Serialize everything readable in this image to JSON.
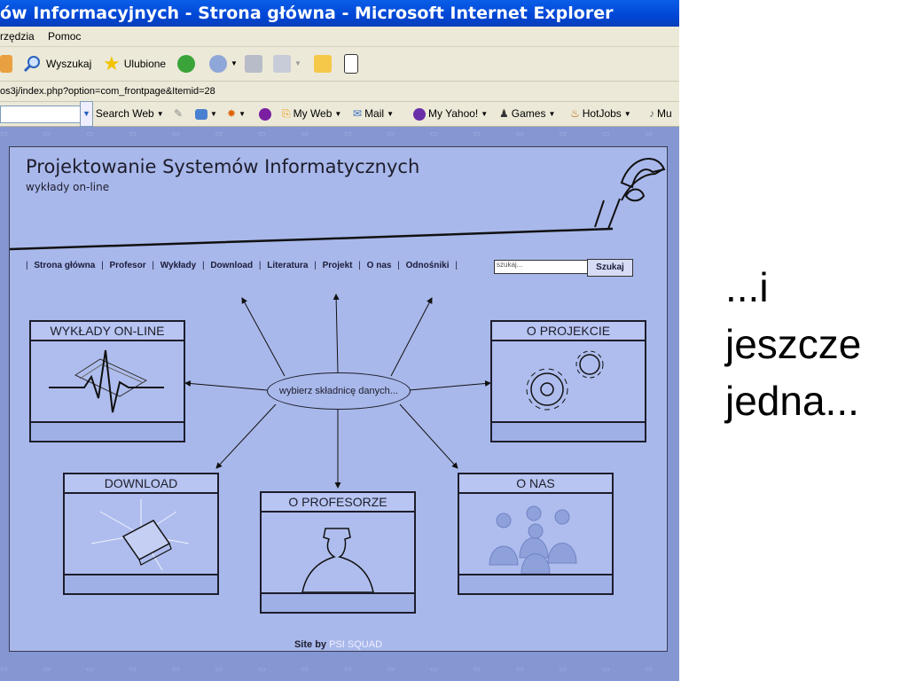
{
  "window": {
    "title": "ów Informacyjnych - Strona główna - Microsoft Internet Explorer"
  },
  "menubar": {
    "items": [
      "rzędzia",
      "Pomoc"
    ]
  },
  "toolbar": {
    "search_label": "Wyszukaj",
    "favorites_label": "Ulubione"
  },
  "address": {
    "url": "os3j/index.php?option=com_frontpage&Itemid=28"
  },
  "yahoo_toolbar": {
    "search_web": "Search Web",
    "items": [
      "My Web",
      "Mail",
      "My Yahoo!",
      "Games",
      "HotJobs",
      "Mu"
    ]
  },
  "site": {
    "title": "Projektowanie Systemów Informatycznych",
    "subtitle": "wykłady on-line",
    "nav": [
      "Strona główna",
      "Profesor",
      "Wykłady",
      "Download",
      "Literatura",
      "Projekt",
      "O nas",
      "Odnośniki"
    ],
    "search_placeholder": "szukaj...",
    "search_button": "Szukaj",
    "center_text": "wybierz składnicę danych...",
    "boxes": {
      "wyklady": "WYKŁADY ON-LINE",
      "projekcie": "O PROJEKCIE",
      "download": "DOWNLOAD",
      "profesorze": "O PROFESORZE",
      "onas": "O NAS"
    },
    "footer_prefix": "Site by",
    "footer_brand": "PSI SQUAD"
  },
  "slide": {
    "line1": "...i",
    "line2": "jeszcze",
    "line3": "jedna..."
  }
}
